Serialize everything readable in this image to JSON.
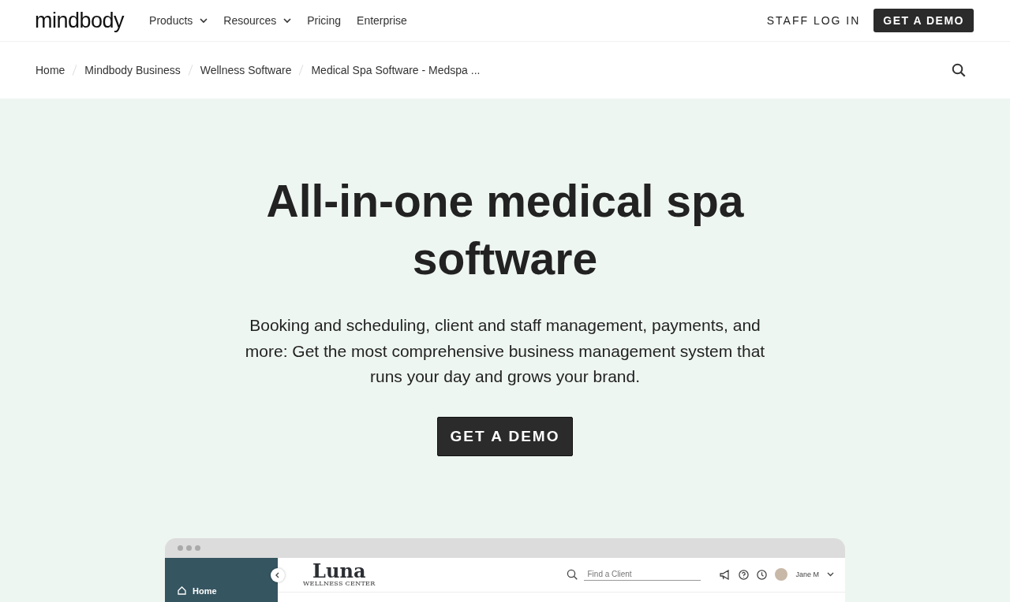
{
  "header": {
    "logo": "mindbody",
    "nav": [
      {
        "label": "Products",
        "dropdown": true
      },
      {
        "label": "Resources",
        "dropdown": true
      },
      {
        "label": "Pricing",
        "dropdown": false
      },
      {
        "label": "Enterprise",
        "dropdown": false
      }
    ],
    "login": "STAFF LOG IN",
    "cta": "GET A DEMO"
  },
  "breadcrumbs": [
    "Home",
    "Mindbody Business",
    "Wellness Software",
    "Medical Spa Software - Medspa ..."
  ],
  "hero": {
    "title": "All-in-one medical spa software",
    "subtitle": "Booking and scheduling, client and staff management, payments, and more: Get the most comprehensive business management system that runs your day and grows your brand.",
    "cta": "GET A DEMO"
  },
  "mockup": {
    "brand": "Luna",
    "brand_tagline": "WELLNESS CENTER",
    "search": {
      "placeholder": "Find a Client"
    },
    "user": "Jane M",
    "sidebar": [
      {
        "label": "Home"
      }
    ]
  }
}
